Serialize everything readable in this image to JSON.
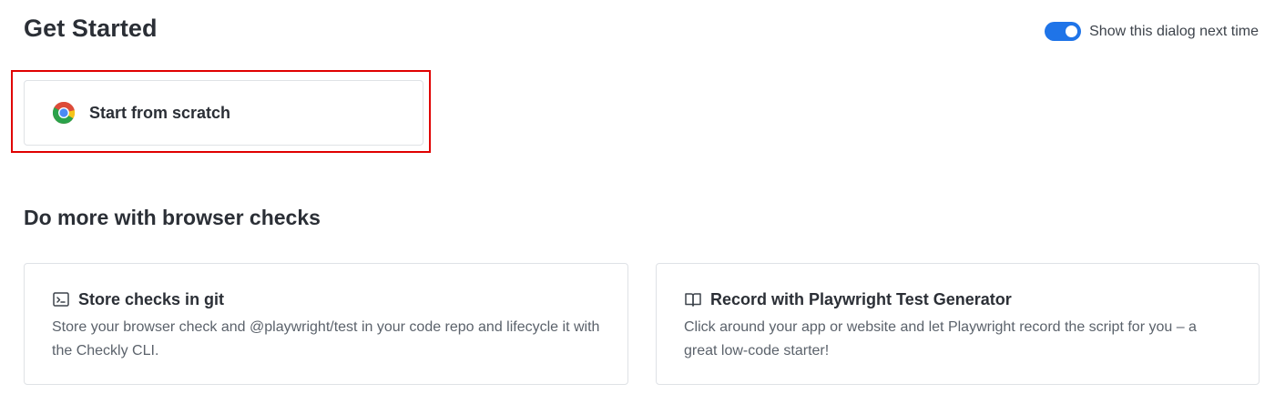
{
  "header": {
    "title": "Get Started",
    "toggle": {
      "label": "Show this dialog next time",
      "checked": true,
      "color": "#1f74e8"
    }
  },
  "start": {
    "label": "Start from scratch",
    "icon": "chrome-icon",
    "highlight_color": "#e00000"
  },
  "more": {
    "title": "Do more with browser checks",
    "cards": [
      {
        "title": "Store checks in git",
        "icon": "terminal-icon",
        "description": "Store your browser check and @playwright/test in your code repo and lifecycle it with the Checkly CLI."
      },
      {
        "title": "Record with Playwright Test Generator",
        "icon": "book-open-icon",
        "description": "Click around your app or website and let Playwright record the script for you – a great low-code starter!"
      }
    ]
  }
}
